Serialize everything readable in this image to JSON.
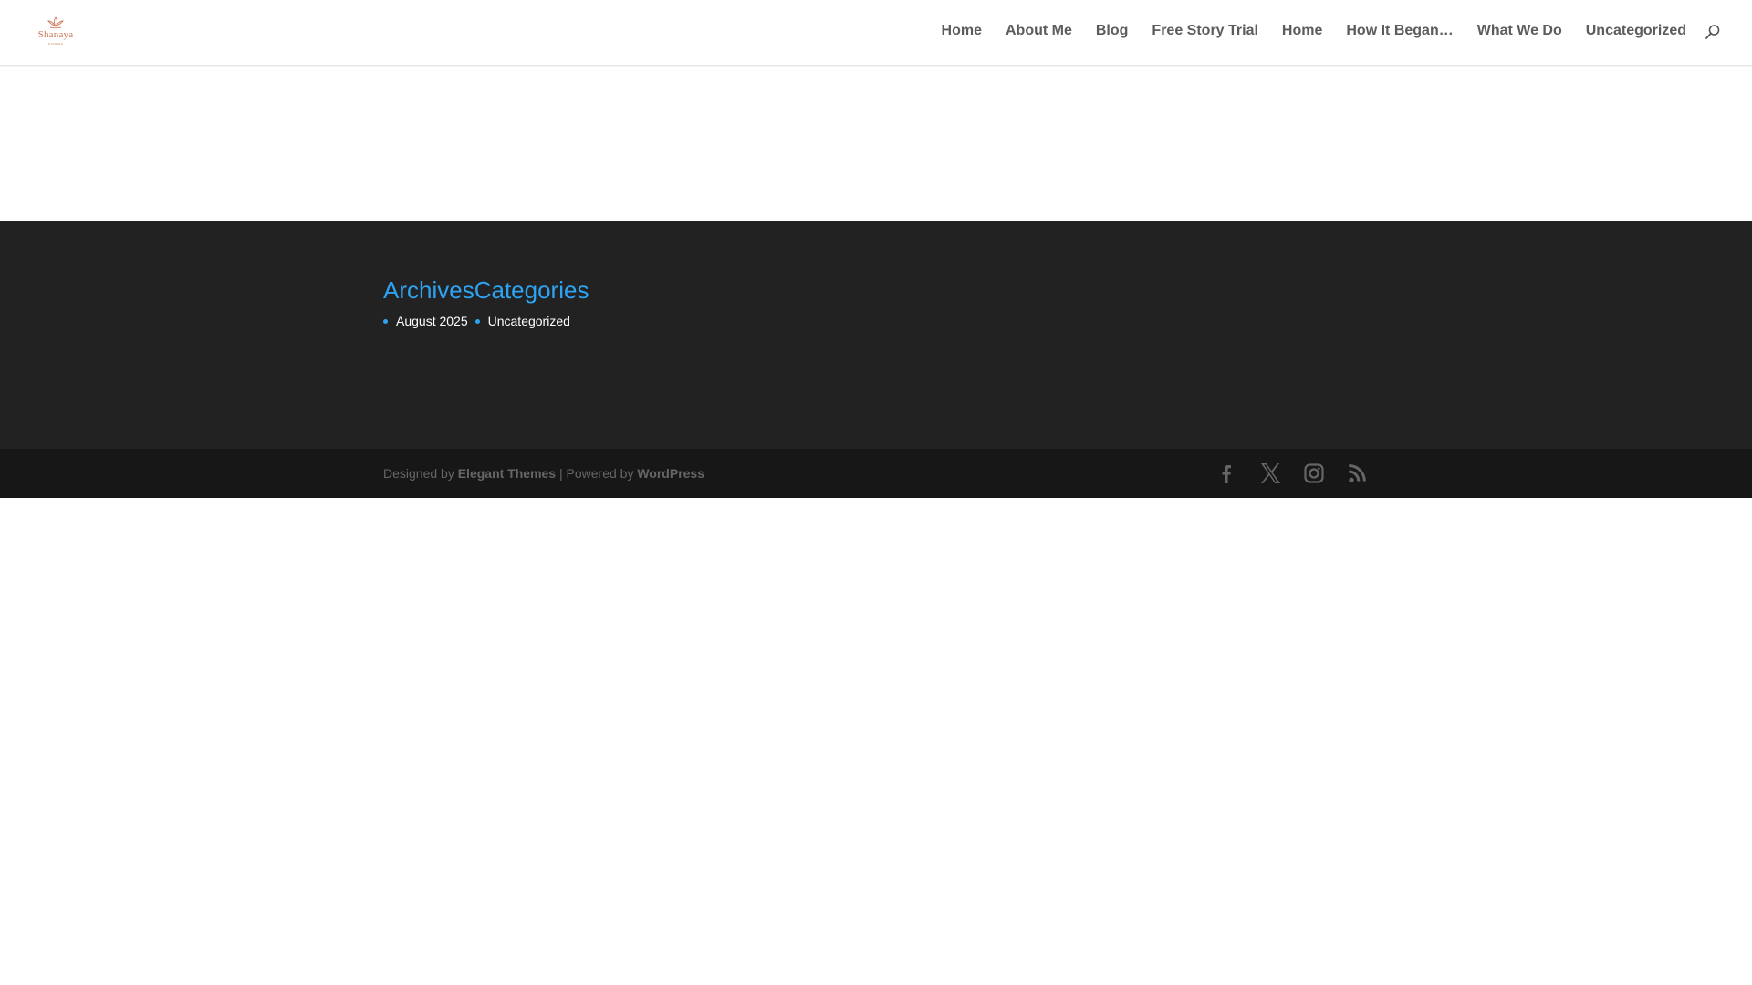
{
  "header": {
    "logo_text": "Shanaya",
    "logo_subtext": "STORIES",
    "nav": [
      {
        "label": "Home"
      },
      {
        "label": "About Me"
      },
      {
        "label": "Blog"
      },
      {
        "label": "Free Story Trial"
      },
      {
        "label": "Home"
      },
      {
        "label": "How It Began…"
      },
      {
        "label": "What We Do"
      },
      {
        "label": "Uncategorized"
      }
    ]
  },
  "widgets": {
    "archives_title": "Archives",
    "categories_title": "Categories",
    "archives_items": [
      "August 2025"
    ],
    "categories_items": [
      "Uncategorized"
    ]
  },
  "footer": {
    "designed_by_prefix": "Designed by ",
    "designer": "Elegant Themes",
    "powered_by_prefix": " | Powered by ",
    "platform": "WordPress",
    "social_icons": [
      "facebook-icon",
      "x-icon",
      "instagram-icon",
      "rss-icon"
    ]
  },
  "colors": {
    "accent": "#2ea3f2",
    "nav_text": "#5c5c5c",
    "footer_bg": "#222222",
    "bottom_bar_bg": "#171717",
    "logo": "#c97a5a"
  }
}
